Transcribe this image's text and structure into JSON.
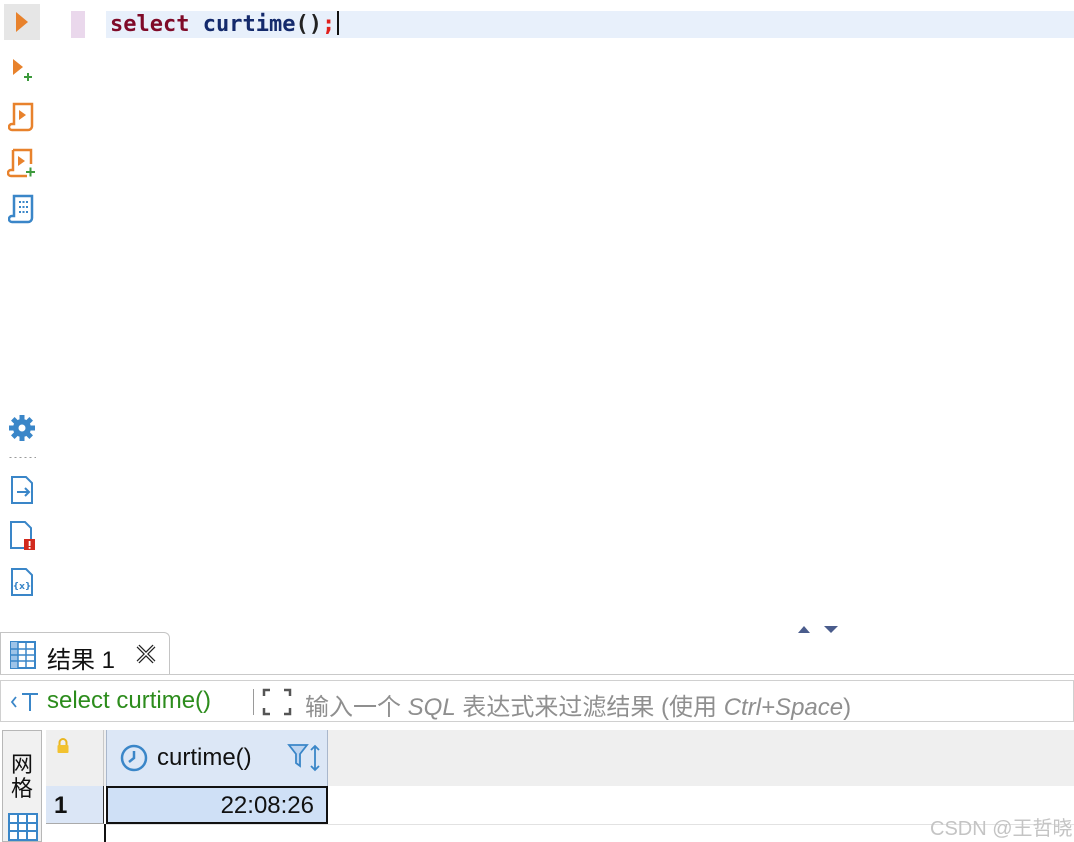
{
  "editor": {
    "keyword": "select",
    "function_name": "curtime",
    "parens": "()",
    "terminator": ";"
  },
  "toolbar": {
    "icons": [
      "execute-icon",
      "execute-new-tab-icon",
      "execute-script-icon",
      "execute-script-new-tab-icon",
      "explain-plan-icon",
      "settings-icon",
      "export-icon",
      "error-log-icon",
      "variables-icon"
    ]
  },
  "results": {
    "tab_label": "结果 1",
    "filter_query": "select curtime()",
    "filter_placeholder_parts": [
      "输入一个 ",
      "SQL",
      " 表达式来过滤结果 ",
      "(使用 ",
      "Ctrl+Space",
      ")"
    ],
    "side_label": "网格",
    "columns": [
      {
        "label": "curtime()"
      }
    ],
    "rows": [
      {
        "num": "1",
        "cells": [
          "22:08:26"
        ]
      }
    ]
  },
  "watermark": "CSDN @王哲晓",
  "colors": {
    "accent_orange": "#e8822c",
    "accent_blue": "#3a86c8",
    "keyword": "#7f0a28",
    "function": "#142a6c",
    "filter_text": "#2c8c1c"
  }
}
